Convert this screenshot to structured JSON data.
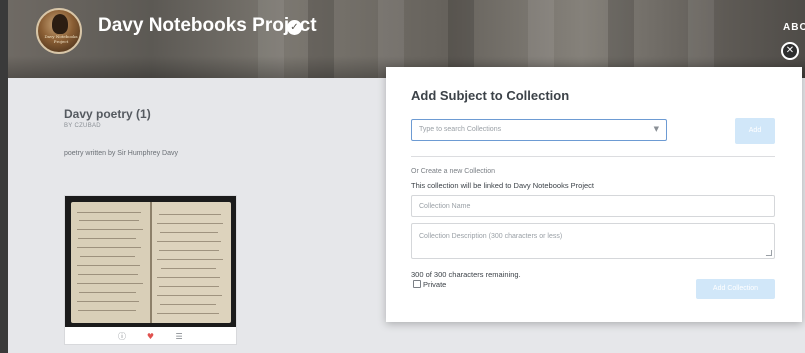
{
  "header": {
    "project_title": "Davy Notebooks Project",
    "avatar_text": "Davy Notebooks Project",
    "nav_about": "ABO"
  },
  "collection": {
    "title": "Davy poetry (1)",
    "by": "BY CZUBAD",
    "description": "poetry written by Sir Humphrey Davy"
  },
  "thumb_icons": [
    "info-icon",
    "heart-icon",
    "list-icon"
  ],
  "modal": {
    "title": "Add Subject to Collection",
    "search_placeholder": "Type to search Collections",
    "add_label": "Add",
    "or_create": "Or Create a new Collection",
    "linked_text": "This collection will be linked to Davy Notebooks Project",
    "name_placeholder": "Collection Name",
    "description_placeholder": "Collection Description (300 characters or less)",
    "remaining_text": "300 of 300 characters remaining.",
    "private_label": "Private",
    "add_collection_label": "Add Collection"
  },
  "colors": {
    "accent_disabled": "#d1e7f9",
    "focus_border": "#6d9bd3",
    "heart": "#e0524f"
  }
}
